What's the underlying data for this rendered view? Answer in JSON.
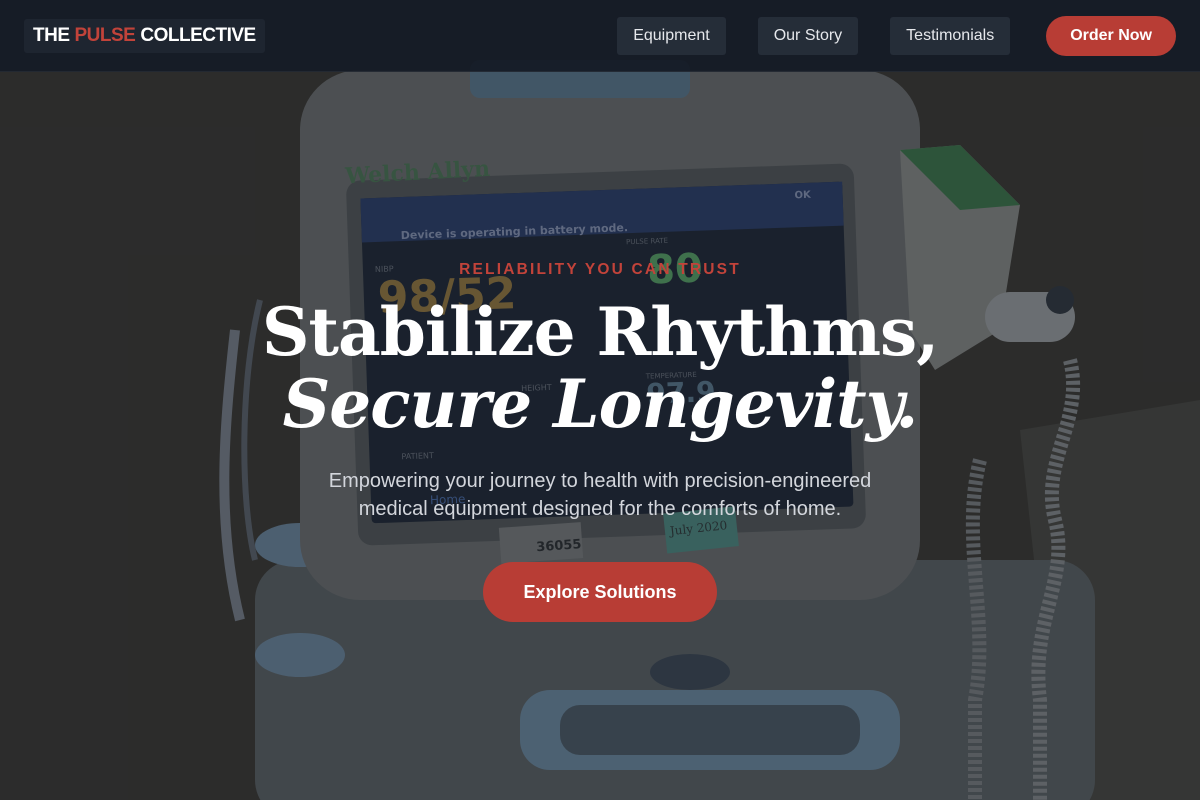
{
  "brand": {
    "part1": "THE",
    "part2": "PULSE",
    "part3": "COLLECTIVE",
    "accent_color": "#c2433a"
  },
  "nav": {
    "links": [
      "Equipment",
      "Our Story",
      "Testimonials"
    ],
    "cta_label": "Order Now"
  },
  "hero": {
    "eyebrow": "RELIABILITY YOU CAN TRUST",
    "headline_line1": "Stabilize Rhythms,",
    "headline_line2": "Secure Longevity.",
    "subtext": "Empowering your journey to health with precision-engineered medical equipment designed for the comforts of home.",
    "cta_label": "Explore Solutions",
    "background_image": {
      "device_brand": "Welch Allyn",
      "status_banner": "Device is operating in battery mode.",
      "ok_label": "OK",
      "nibp_label": "NIBP",
      "nibp_value": "98/52",
      "pulse_label": "PULSE RATE",
      "pulse_value": "80",
      "temperature_label": "TEMPERATURE",
      "temperature_value": "97.9",
      "height_label": "HEIGHT",
      "patient_label": "PATIENT",
      "home_label": "Home",
      "sticker_number": "36055",
      "sticker_date": "July 2020"
    }
  },
  "colors": {
    "nav_bg": "#161c26",
    "primary": "#b83d35"
  }
}
